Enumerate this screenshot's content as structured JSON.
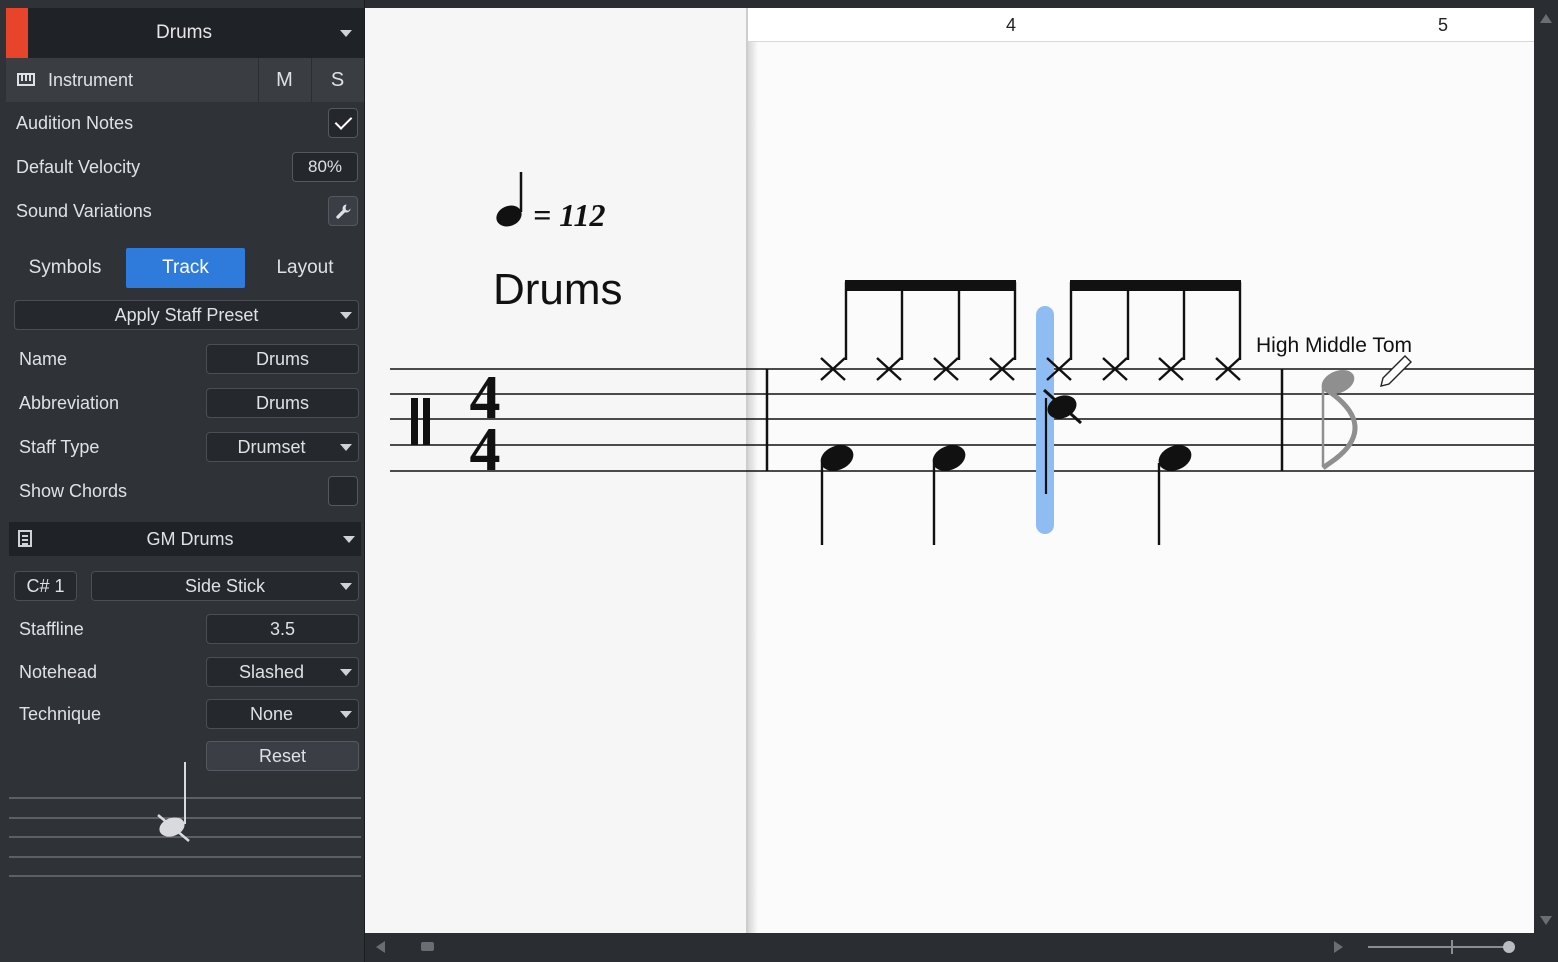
{
  "inspector": {
    "track_name": "Drums",
    "track_color": "#e8442c",
    "instrument_label": "Instrument",
    "mute_label": "M",
    "solo_label": "S",
    "audition_notes_label": "Audition Notes",
    "audition_notes_checked": true,
    "default_velocity_label": "Default Velocity",
    "default_velocity_value": "80%",
    "sound_variations_label": "Sound Variations",
    "tabs": [
      {
        "label": "Symbols",
        "active": false
      },
      {
        "label": "Track",
        "active": true
      },
      {
        "label": "Layout",
        "active": false
      }
    ],
    "apply_staff_preset_label": "Apply Staff Preset",
    "name_label": "Name",
    "name_value": "Drums",
    "abbreviation_label": "Abbreviation",
    "abbreviation_value": "Drums",
    "staff_type_label": "Staff Type",
    "staff_type_value": "Drumset",
    "show_chords_label": "Show Chords",
    "show_chords_checked": false,
    "drum_map": "GM Drums",
    "pitch": "C# 1",
    "instrument_sound": "Side Stick",
    "staffline_label": "Staffline",
    "staffline_value": "3.5",
    "notehead_label": "Notehead",
    "notehead_value": "Slashed",
    "technique_label": "Technique",
    "technique_value": "None",
    "reset_label": "Reset"
  },
  "score": {
    "bar_numbers": [
      "4",
      "5"
    ],
    "tempo_value": "= 112",
    "staff_title": "Drums",
    "time_signature_top": "4",
    "time_signature_bottom": "4",
    "hover_tooltip": "High Middle Tom",
    "highlight_color": "#8fbdf3"
  },
  "icons": {
    "instrument": "keyboard-icon",
    "sound_variations": "wrench-icon",
    "drum_map": "document-icon",
    "cursor": "pencil-icon"
  }
}
